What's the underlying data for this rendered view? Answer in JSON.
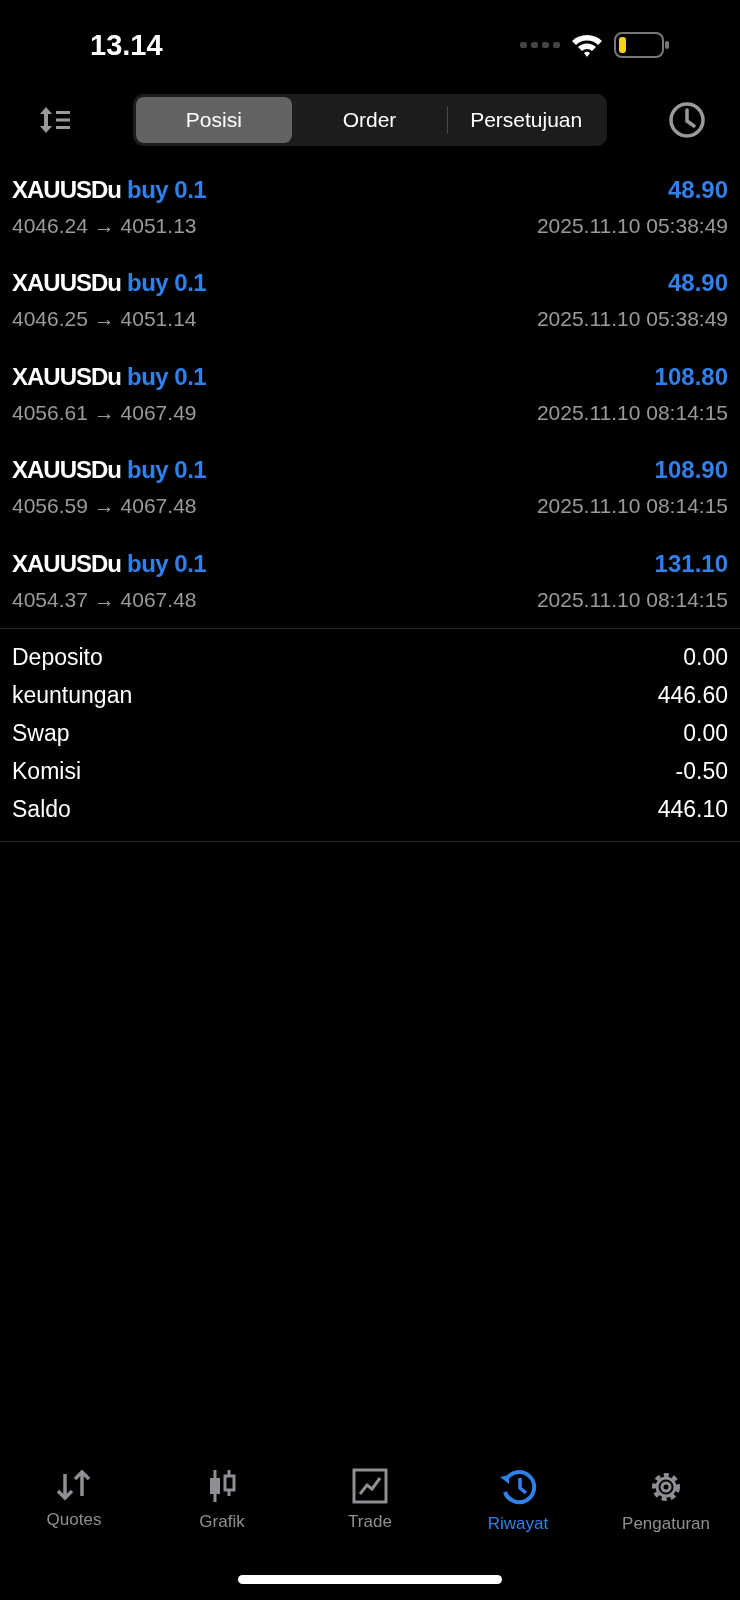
{
  "status_bar": {
    "time": "13.14"
  },
  "tabs": [
    {
      "label": "Posisi",
      "selected": true
    },
    {
      "label": "Order",
      "selected": false
    },
    {
      "label": "Persetujuan",
      "selected": false
    }
  ],
  "deals": [
    {
      "symbol": "XAUUSDu",
      "side": "buy 0.1",
      "prices": "4046.24 → 4051.13",
      "profit": "48.90",
      "time": "2025.11.10 05:38:49"
    },
    {
      "symbol": "XAUUSDu",
      "side": "buy 0.1",
      "prices": "4046.25 → 4051.14",
      "profit": "48.90",
      "time": "2025.11.10 05:38:49"
    },
    {
      "symbol": "XAUUSDu",
      "side": "buy 0.1",
      "prices": "4056.61 → 4067.49",
      "profit": "108.80",
      "time": "2025.11.10 08:14:15"
    },
    {
      "symbol": "XAUUSDu",
      "side": "buy 0.1",
      "prices": "4056.59 → 4067.48",
      "profit": "108.90",
      "time": "2025.11.10 08:14:15"
    },
    {
      "symbol": "XAUUSDu",
      "side": "buy 0.1",
      "prices": "4054.37 → 4067.48",
      "profit": "131.10",
      "time": "2025.11.10 08:14:15"
    }
  ],
  "summary": [
    {
      "label": "Deposito",
      "value": "0.00"
    },
    {
      "label": "keuntungan",
      "value": "446.60"
    },
    {
      "label": "Swap",
      "value": "0.00"
    },
    {
      "label": "Komisi",
      "value": "-0.50"
    },
    {
      "label": "Saldo",
      "value": "446.10"
    }
  ],
  "bottom_nav": [
    {
      "label": "Quotes",
      "selected": false
    },
    {
      "label": "Grafik",
      "selected": false
    },
    {
      "label": "Trade",
      "selected": false
    },
    {
      "label": "Riwayat",
      "selected": true
    },
    {
      "label": "Pengaturan",
      "selected": false
    }
  ]
}
